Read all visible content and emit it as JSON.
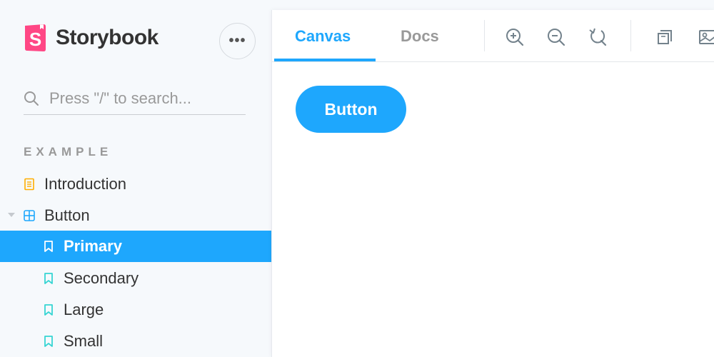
{
  "brand": {
    "name": "Storybook",
    "logo_letter": "S",
    "logo_color": "#ff4785"
  },
  "menu": {
    "glyph": "•••"
  },
  "search": {
    "placeholder": "Press \"/\" to search...",
    "icon": "search-icon"
  },
  "sidebar": {
    "section": "EXAMPLE",
    "items": [
      {
        "label": "Introduction",
        "icon": "document-icon",
        "icon_color": "#ffae00"
      },
      {
        "label": "Button",
        "icon": "component-icon",
        "icon_color": "#1ea7fd"
      },
      {
        "label": "Primary",
        "icon": "bookmark-icon",
        "icon_color": "#ffffff",
        "selected": true
      },
      {
        "label": "Secondary",
        "icon": "bookmark-icon",
        "icon_color": "#37d5d3"
      },
      {
        "label": "Large",
        "icon": "bookmark-icon",
        "icon_color": "#37d5d3"
      },
      {
        "label": "Small",
        "icon": "bookmark-icon",
        "icon_color": "#37d5d3"
      }
    ]
  },
  "toolbar": {
    "tabs": [
      {
        "label": "Canvas",
        "active": true
      },
      {
        "label": "Docs",
        "active": false
      }
    ],
    "tools": [
      "zoom-in-icon",
      "zoom-out-icon",
      "zoom-reset-icon",
      "outline-icon",
      "background-icon"
    ]
  },
  "preview": {
    "button_label": "Button"
  },
  "colors": {
    "accent": "#1ea7fd",
    "sidebar_bg": "#f6f9fc"
  }
}
